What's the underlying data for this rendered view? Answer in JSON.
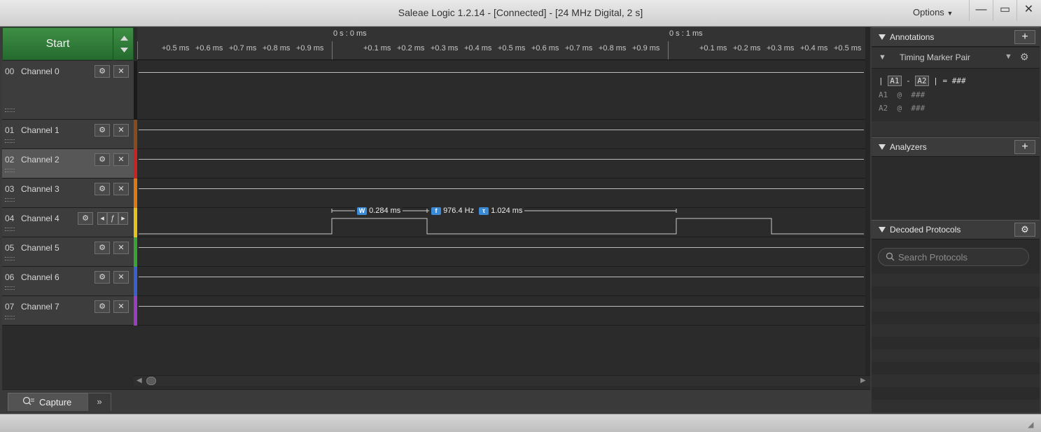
{
  "window": {
    "title": "Saleae Logic 1.2.14 - [Connected] - [24 MHz Digital, 2 s]",
    "options_label": "Options",
    "minimize": "—",
    "maximize": "▭",
    "close": "✕"
  },
  "toolbar": {
    "start_label": "Start"
  },
  "ruler": {
    "markers": [
      "0 s : 0 ms",
      "0 s : 1 ms"
    ],
    "ticks": [
      "+0.5 ms",
      "+0.6 ms",
      "+0.7 ms",
      "+0.8 ms",
      "+0.9 ms",
      "+0.1 ms",
      "+0.2 ms",
      "+0.3 ms",
      "+0.4 ms",
      "+0.5 ms",
      "+0.6 ms",
      "+0.7 ms",
      "+0.8 ms",
      "+0.9 ms",
      "+0.1 ms",
      "+0.2 ms",
      "+0.3 ms",
      "+0.4 ms",
      "+0.5 ms"
    ]
  },
  "channels": [
    {
      "num": "00",
      "name": "Channel 0",
      "color": "#2b2b2b"
    },
    {
      "num": "01",
      "name": "Channel 1",
      "color": "#8b4a1c"
    },
    {
      "num": "02",
      "name": "Channel 2",
      "color": "#cc2222"
    },
    {
      "num": "03",
      "name": "Channel 3",
      "color": "#e07a10"
    },
    {
      "num": "04",
      "name": "Channel 4",
      "color": "#e3c21a"
    },
    {
      "num": "05",
      "name": "Channel 5",
      "color": "#3aa336"
    },
    {
      "num": "06",
      "name": "Channel 6",
      "color": "#3b5fcf"
    },
    {
      "num": "07",
      "name": "Channel 7",
      "color": "#9a3fc2"
    }
  ],
  "measurements": {
    "width_badge": "W",
    "width": "0.284 ms",
    "freq_badge": "f",
    "frequency": "976.4 Hz",
    "period_badge": "τ",
    "period": "1.024 ms"
  },
  "tabs": {
    "capture": "Capture",
    "more": "»"
  },
  "annotations": {
    "title": "Annotations",
    "marker_pair": "Timing Marker Pair",
    "formula_a1": "A1",
    "formula_a2": "A2",
    "formula_result": "= ###",
    "a1_line": "A1  @  ###",
    "a2_line": "A2  @  ###"
  },
  "analyzers": {
    "title": "Analyzers"
  },
  "decoded": {
    "title": "Decoded Protocols",
    "search_placeholder": "Search Protocols"
  }
}
